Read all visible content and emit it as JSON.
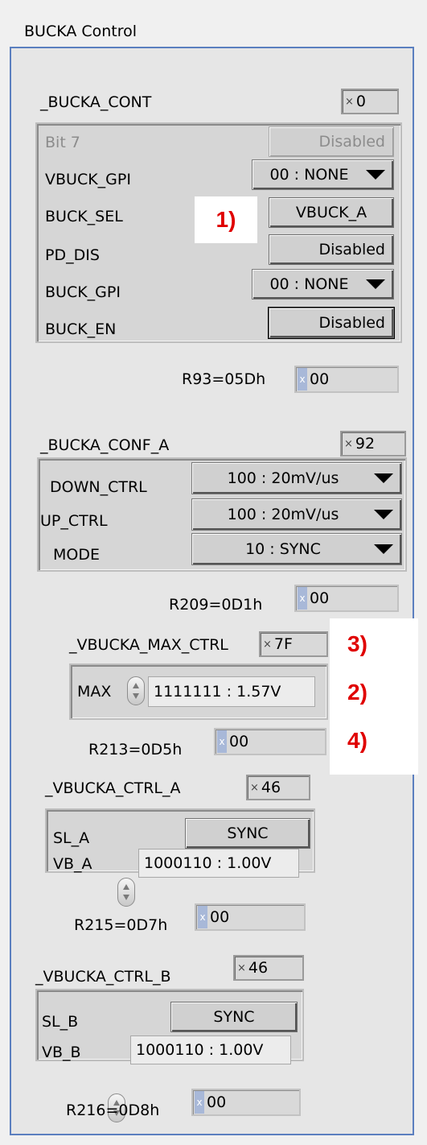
{
  "window_title": "BUCKA Control",
  "bucka_cont": {
    "name": "_BUCKA_CONT",
    "hex": "0",
    "rows": [
      {
        "label": "Bit 7",
        "value": "Disabled"
      },
      {
        "label": "VBUCK_GPI",
        "value": "00 : NONE"
      },
      {
        "label": "BUCK_SEL",
        "value": "VBUCK_A"
      },
      {
        "label": "PD_DIS",
        "value": "Disabled"
      },
      {
        "label": "BUCK_GPI",
        "value": "00 : NONE"
      },
      {
        "label": "BUCK_EN",
        "value": "Disabled"
      }
    ],
    "reg_label": "R93=05Dh",
    "reg_value": "00"
  },
  "bucka_conf_a": {
    "name": "_BUCKA_CONF_A",
    "hex": "92",
    "rows": [
      {
        "label": "DOWN_CTRL",
        "value": "100 : 20mV/us"
      },
      {
        "label": "UP_CTRL",
        "value": "100 : 20mV/us"
      },
      {
        "label": "MODE",
        "value": "10 : SYNC"
      }
    ],
    "reg_label": "R209=0D1h",
    "reg_value": "00"
  },
  "vbucka_max_ctrl": {
    "name": "_VBUCKA_MAX_CTRL",
    "hex": "7F",
    "field_label": "MAX",
    "field_value": "1111111 : 1.57V",
    "reg_label": "R213=0D5h",
    "reg_value": "00"
  },
  "vbucka_ctrl_a": {
    "name": "_VBUCKA_CTRL_A",
    "hex": "46",
    "sl_label": "SL_A",
    "sl_value": "SYNC",
    "vb_label": "VB_A",
    "vb_value": "1000110 : 1.00V",
    "reg_label": "R215=0D7h",
    "reg_value": "00"
  },
  "vbucka_ctrl_b": {
    "name": "_VBUCKA_CTRL_B",
    "hex": "46",
    "sl_label": "SL_B",
    "sl_value": "SYNC",
    "vb_label": "VB_B",
    "vb_value": "1000110 : 1.00V",
    "reg_label": "R216=0D8h",
    "reg_value": "00"
  },
  "annotations": [
    "1)",
    "3)",
    "2)",
    "4)"
  ],
  "icons": {
    "hex_prefix": "x-radix-icon",
    "spinner": "increment-decrement-icon"
  },
  "colors": {
    "frame_border": "#5b7fbf",
    "annotation_red": "#e00000"
  }
}
